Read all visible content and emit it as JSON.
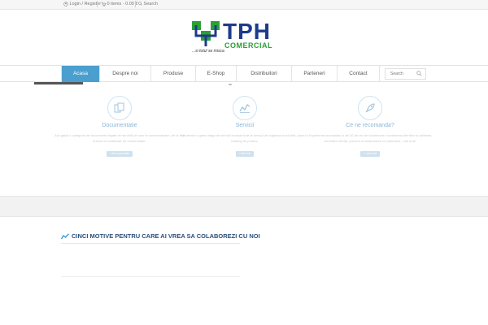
{
  "topbar": {
    "login_label": "Login / Register",
    "cart_label": "0 items - 0.00 €",
    "search_label": "Search"
  },
  "logo": {
    "brand": "TPH",
    "sub": "COMERCIAL",
    "slogan": "...si totul se misca",
    "colors": {
      "green": "#2aa137",
      "blue": "#1e3a8a"
    }
  },
  "nav": {
    "tabs": [
      {
        "label": "Acasa",
        "active": true
      },
      {
        "label": "Despre noi"
      },
      {
        "label": "Produse"
      },
      {
        "label": "E-Shop"
      },
      {
        "label": "Distribuitori"
      },
      {
        "label": "Parteneri"
      },
      {
        "label": "Contact"
      }
    ],
    "search_placeholder": "Search",
    "accent": "#4a9fcf"
  },
  "services": [
    {
      "icon": "documents-icon",
      "title": "Documentatie",
      "desc": "Aici gasiti o categorie de documente legate de serviciii pe care le comercializam, de la fise tehnice la certificate de conformitate.",
      "button": "» Documentatie"
    },
    {
      "icon": "chart-line-icon",
      "title": "Servicii",
      "desc": "Va oferim o gama larga de servicii incepand de la servicii de logistica si achizitii, pana la training de produs.",
      "button": "» Servicii"
    },
    {
      "icon": "rocket-icon",
      "title": "Ce ne recomanda?",
      "desc": "Experienta acumulata in cei 20 de ani de functionare, increderea clientilor si calitatea serviciilor oferite, precum si colaborarea cu partenerii...mai mult.",
      "button": "» mai mult"
    }
  ],
  "section": {
    "icon": "trend-icon",
    "heading": "CINCI MOTIVE PENTRU CARE AI VREA SA COLABOREZI CU NOI"
  }
}
